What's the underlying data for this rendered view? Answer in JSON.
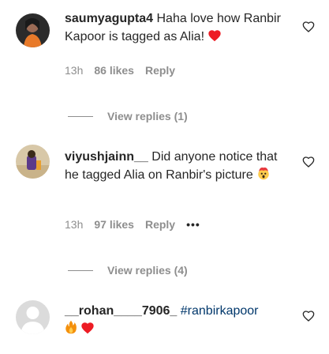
{
  "comments": [
    {
      "username": "saumyagupta4",
      "text": "Haha love how Ranbir Kapoor is tagged as Alia!",
      "emoji": "red-heart",
      "time": "13h",
      "likes": "86 likes",
      "reply_label": "Reply"
    },
    {
      "username": "viyushjainn__",
      "text": "Did anyone notice that he tagged Alia on Ranbir's picture",
      "emoji": "exploding-head",
      "time": "13h",
      "likes": "97 likes",
      "reply_label": "Reply",
      "more": "•••"
    },
    {
      "username": "__rohan____7906_",
      "hashtag": "#ranbirkapoor",
      "emoji": "fire-and-heart"
    }
  ],
  "view_replies": [
    {
      "label": "View replies (1)"
    },
    {
      "label": "View replies (4)"
    }
  ],
  "colors": {
    "text": "#262626",
    "secondary": "#8e8e8e",
    "heart": "#ed4956",
    "hashtag": "#00376b"
  }
}
